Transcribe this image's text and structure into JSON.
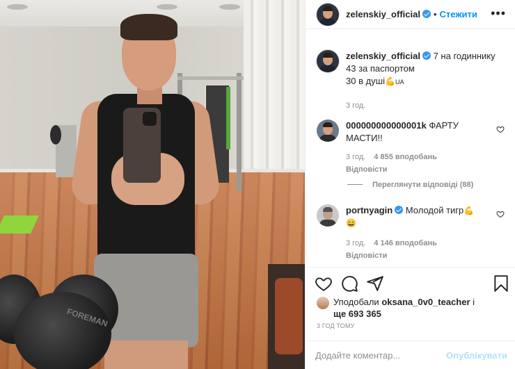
{
  "post": {
    "author": "zelenskiy_official",
    "follow_label": "Стежити",
    "more_label": "•••",
    "caption_lines": [
      "7 на годиннику",
      "43 за паспортом",
      "30 в душі"
    ],
    "caption_emoji": "💪",
    "caption_flag": "UA",
    "caption_time": "3 год."
  },
  "comments": [
    {
      "username": "000000000000001k",
      "text": "ФАРТУ МАСТИ!!",
      "time": "3 год.",
      "likes": "4 855 вподобань",
      "reply_label": "Відповісти",
      "verified": false
    },
    {
      "username": "portnyagin",
      "text": "Молодой тигр",
      "emoji": "💪",
      "emoji2": "😄",
      "time": "3 год.",
      "likes": "4 146 вподобань",
      "reply_label": "Відповісти",
      "verified": true
    }
  ],
  "view_replies_label": "Переглянути відповіді (88)",
  "likes_summary": {
    "prefix": "Уподобали",
    "user": "oksana_0v0_teacher",
    "and": "і",
    "more": "ще 693 365"
  },
  "posted_ago": "3 ГОД ТОМУ",
  "add_comment": {
    "placeholder": "Додайте коментар...",
    "publish_label": "Опублікувати"
  },
  "photo_text": {
    "dumbbell_brand": "FOREMAN"
  },
  "colors": {
    "link_blue": "#0095f6",
    "verified_blue": "#3897f0",
    "muted": "#8e8e8e",
    "publish_disabled": "#b2dffc"
  },
  "icons": [
    "heart-icon",
    "comment-icon",
    "share-icon",
    "bookmark-icon",
    "verified-icon",
    "more-icon"
  ]
}
